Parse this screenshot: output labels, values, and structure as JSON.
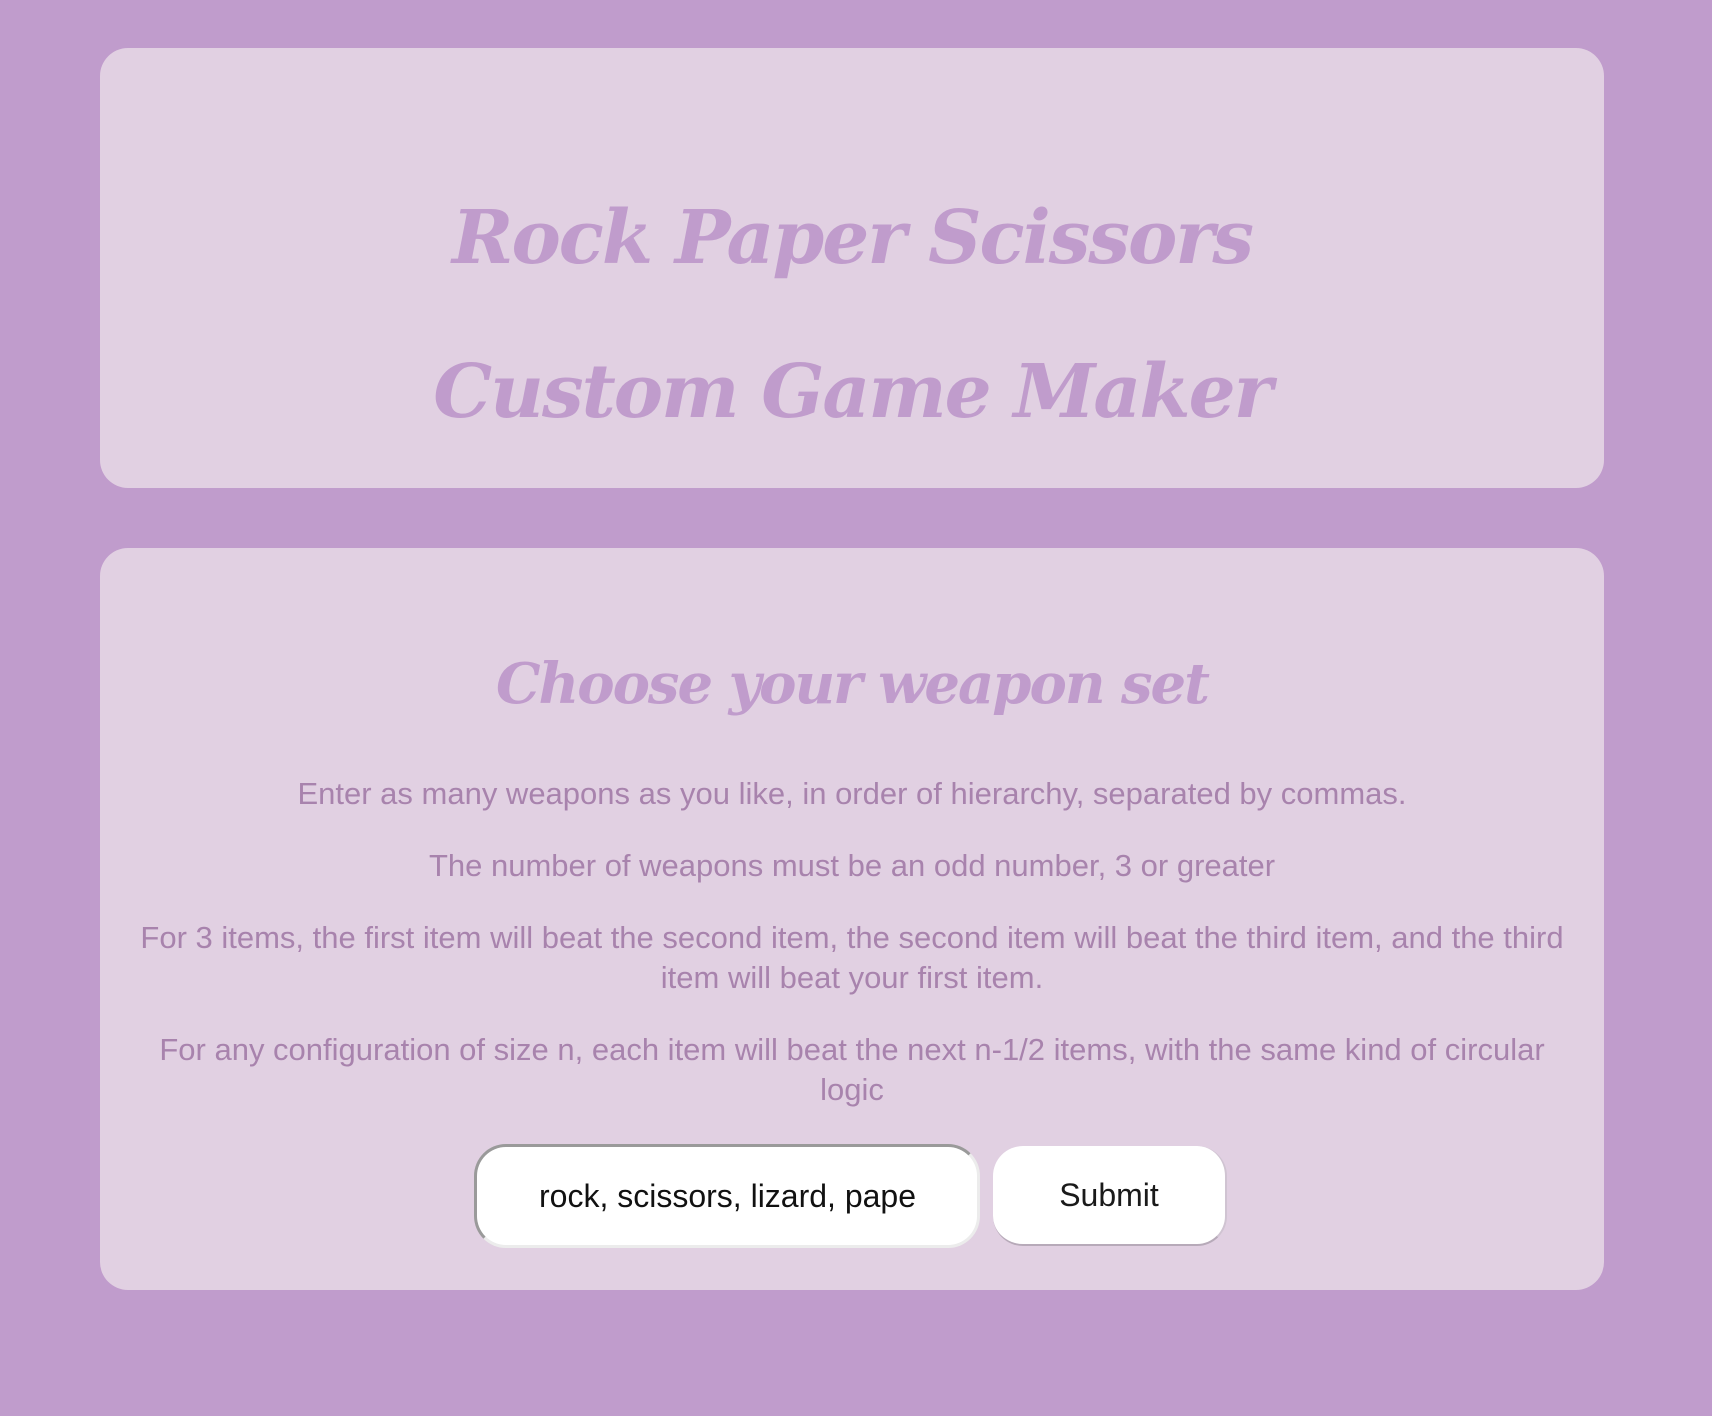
{
  "header": {
    "title_line_1": "Rock Paper Scissors",
    "title_line_2": "Custom Game Maker"
  },
  "weapon_form": {
    "heading": "Choose your weapon set",
    "instructions": [
      "Enter as many weapons as you like, in order of hierarchy, separated by commas.",
      "The number of weapons must be an odd number, 3 or greater",
      "For 3 items, the first item will beat the second item, the second item will beat the third item, and the third item will beat your first item.",
      "For any configuration of size n, each item will beat the next n-1/2 items, with the same kind of circular logic"
    ],
    "input_value": "rock, scissors, lizard, paper, spock",
    "submit_label": "Submit"
  },
  "colors": {
    "page_background": "#c09ccc",
    "card_background": "#e1d0e2",
    "title_color": "#c09ccc",
    "text_color": "#a883ad"
  }
}
